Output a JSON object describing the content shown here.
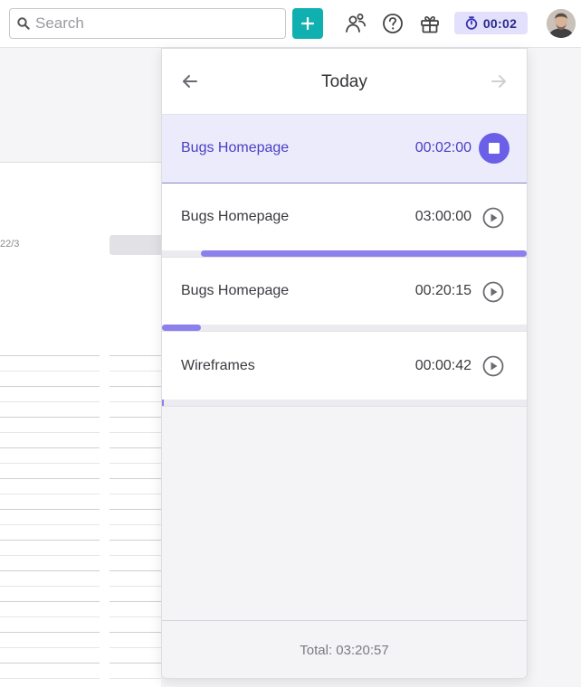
{
  "search": {
    "placeholder": "Search"
  },
  "header": {
    "timer_label": "00:02",
    "accent": "#10b0b0",
    "timer_bg": "#e2e0fb",
    "icons": [
      "search-icon",
      "plus-icon",
      "people-icon",
      "help-icon",
      "gift-icon",
      "stopwatch-icon",
      "avatar"
    ]
  },
  "background": {
    "date_fragment": "22/3"
  },
  "panel": {
    "title": "Today",
    "entries": [
      {
        "name": "Bugs Homepage",
        "time": "00:02:00",
        "state": "running",
        "progress": null
      },
      {
        "name": "Bugs Homepage",
        "time": "03:00:00",
        "state": "stopped",
        "progress": {
          "start": 0.106,
          "end": 1.0
        }
      },
      {
        "name": "Bugs Homepage",
        "time": "00:20:15",
        "state": "stopped",
        "progress": {
          "start": 0.0,
          "end": 0.106
        }
      },
      {
        "name": "Wireframes",
        "time": "00:00:42",
        "state": "stopped",
        "progress": {
          "start": 0.0,
          "end": 0.004
        }
      }
    ],
    "total": "Total: 03:20:57",
    "progress_color": "#8b80ec",
    "active_color": "#6a5fe6"
  }
}
